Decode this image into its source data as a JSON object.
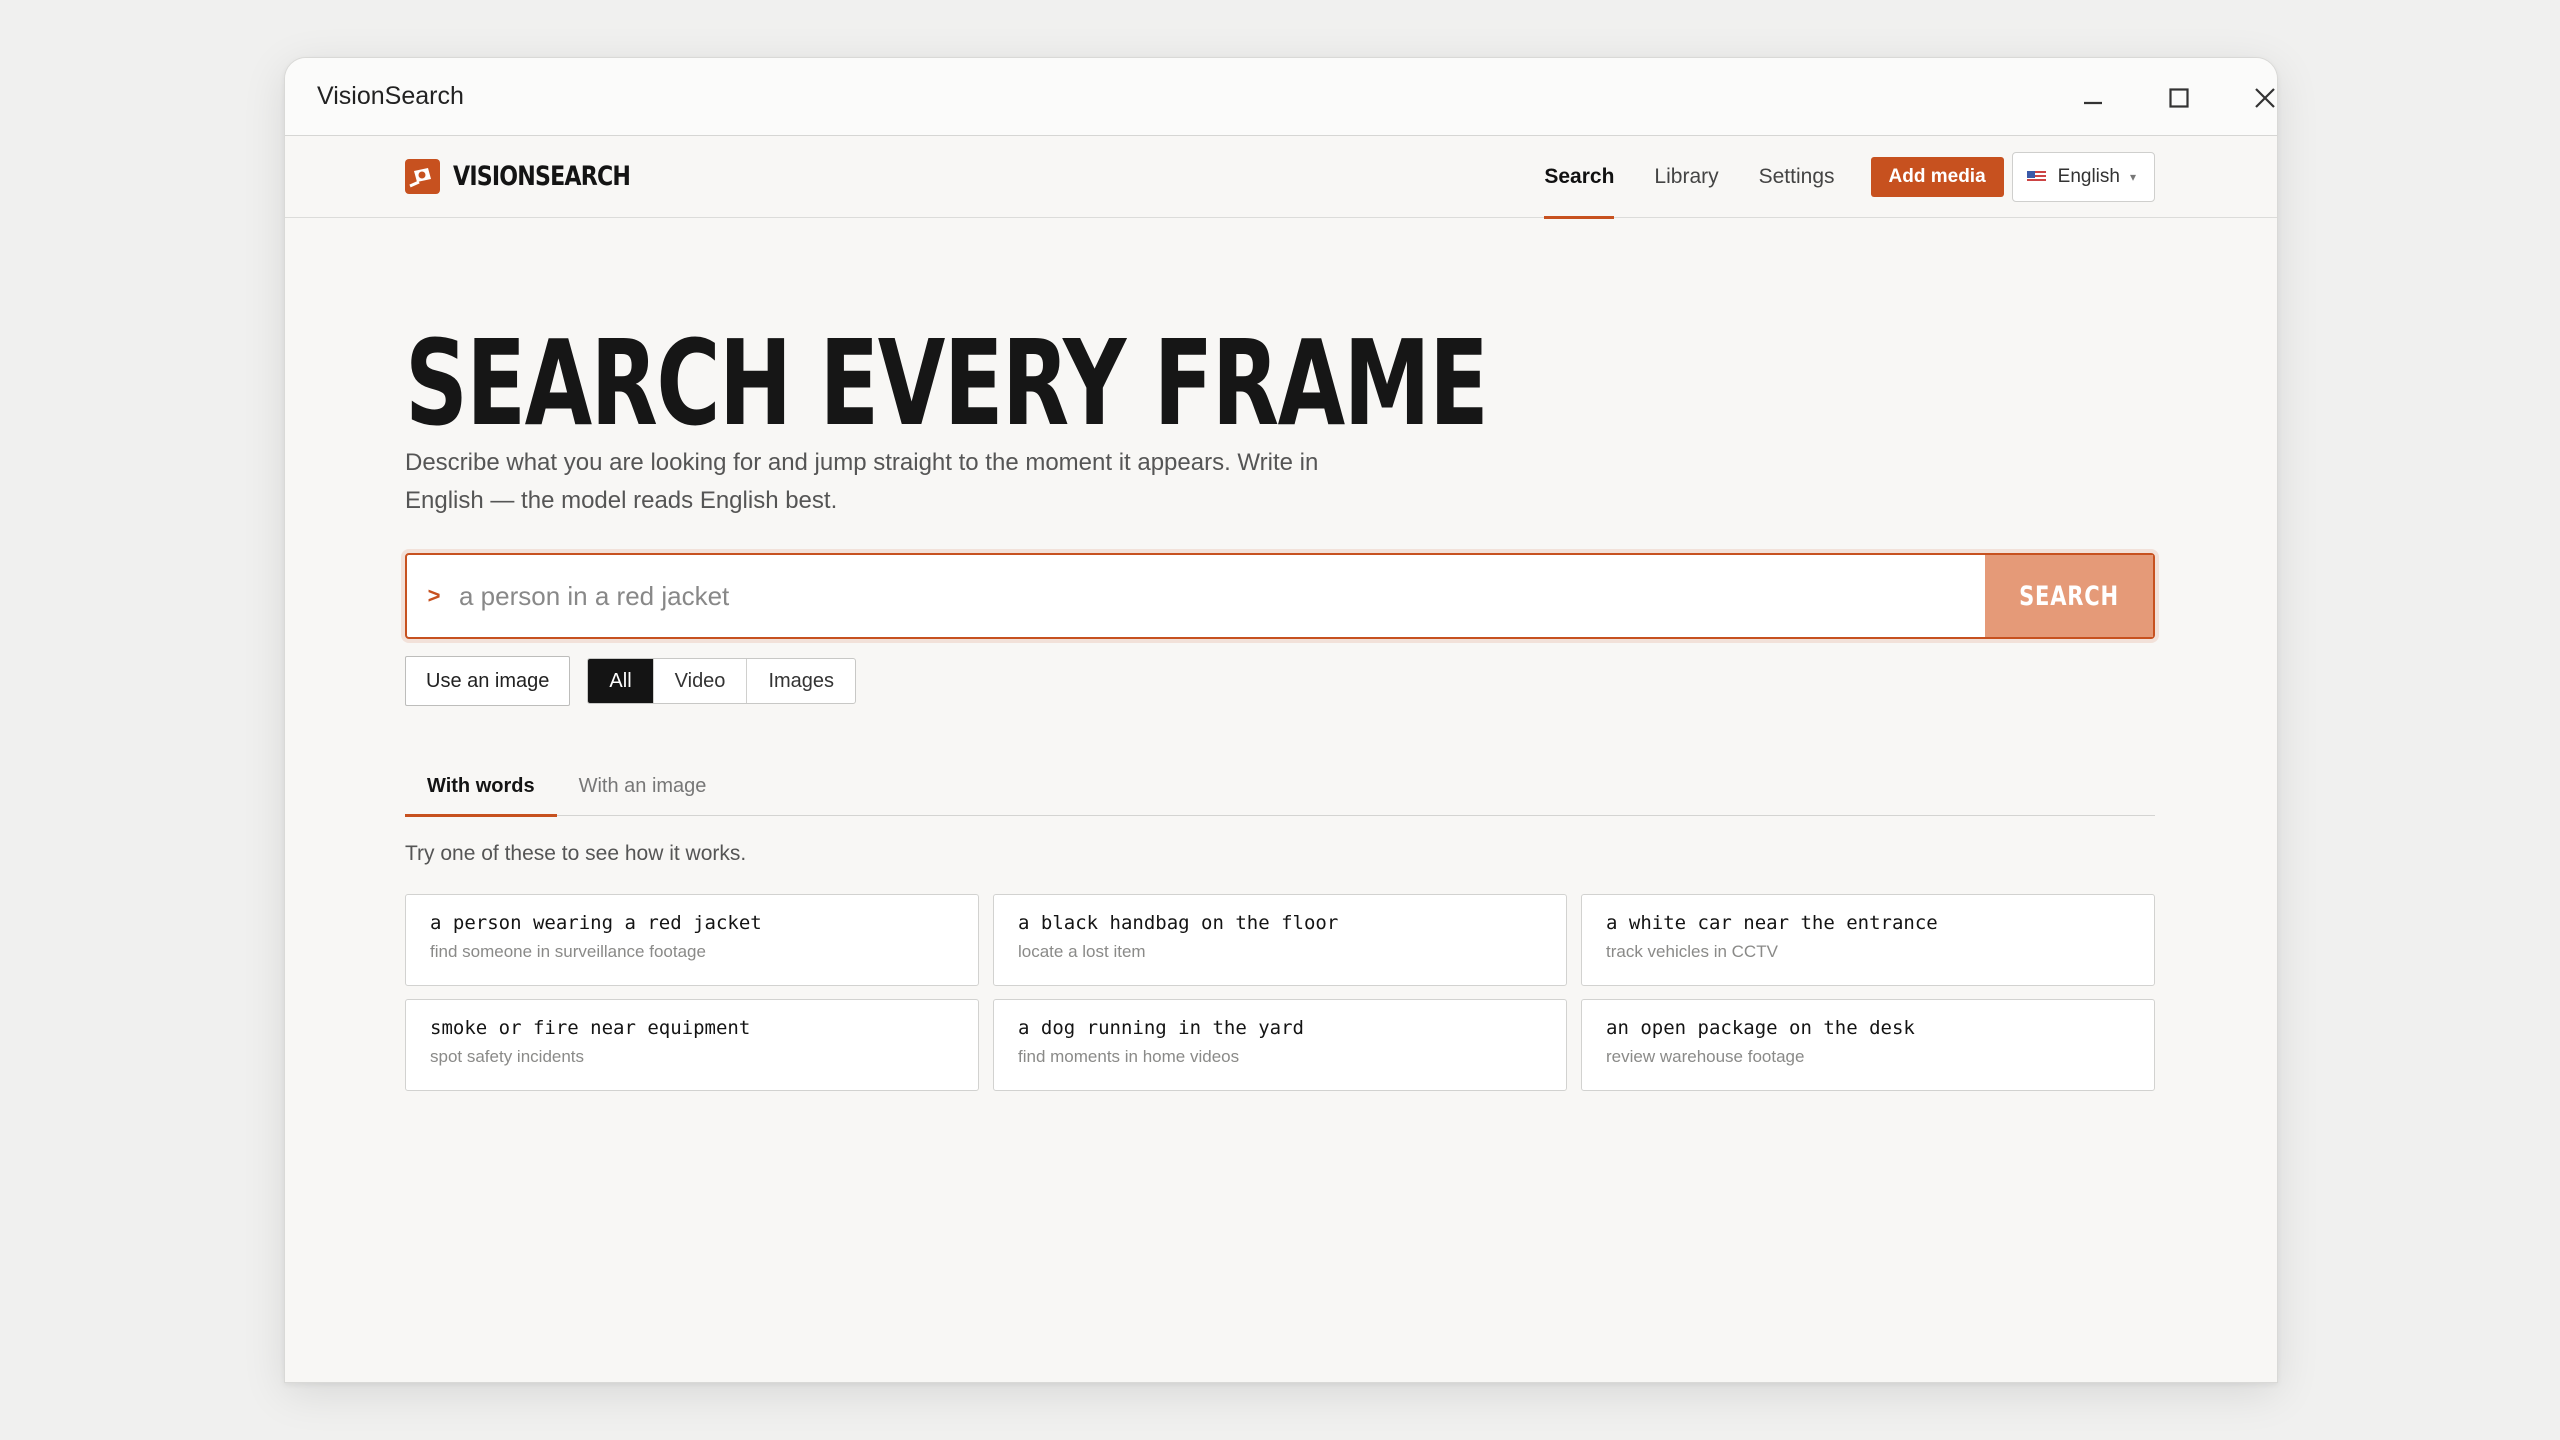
{
  "window": {
    "title": "VisionSearch"
  },
  "brand": {
    "name": "VISIONSEARCH"
  },
  "nav": {
    "links": [
      "Search",
      "Library",
      "Settings"
    ],
    "active": "Search",
    "add_media": "Add media",
    "language": "English"
  },
  "hero": {
    "title": "SEARCH EVERY FRAME",
    "subtitle": "Describe what you are looking for and jump straight to the moment it appears. Write in English — the model reads English best."
  },
  "search": {
    "prompt": ">",
    "placeholder": "a person in a red jacket",
    "value": "",
    "button": "SEARCH"
  },
  "filters": {
    "use_image": "Use an image",
    "types": [
      "All",
      "Video",
      "Images"
    ],
    "active_type": "All"
  },
  "tabs": {
    "items": [
      "With words",
      "With an image"
    ],
    "active": "With words"
  },
  "examples": {
    "hint": "Try one of these to see how it works.",
    "cards": [
      {
        "query": "a person wearing a red jacket",
        "sub": "find someone in surveillance footage"
      },
      {
        "query": "a black handbag on the floor",
        "sub": "locate a lost item"
      },
      {
        "query": "a white car near the entrance",
        "sub": "track vehicles in CCTV"
      },
      {
        "query": "smoke or fire near equipment",
        "sub": "spot safety incidents"
      },
      {
        "query": "a dog running in the yard",
        "sub": "find moments in home videos"
      },
      {
        "query": "an open package on the desk",
        "sub": "review warehouse footage"
      }
    ]
  },
  "colors": {
    "accent": "#c7511f",
    "accent_light": "#e59a78",
    "dark": "#141414"
  }
}
